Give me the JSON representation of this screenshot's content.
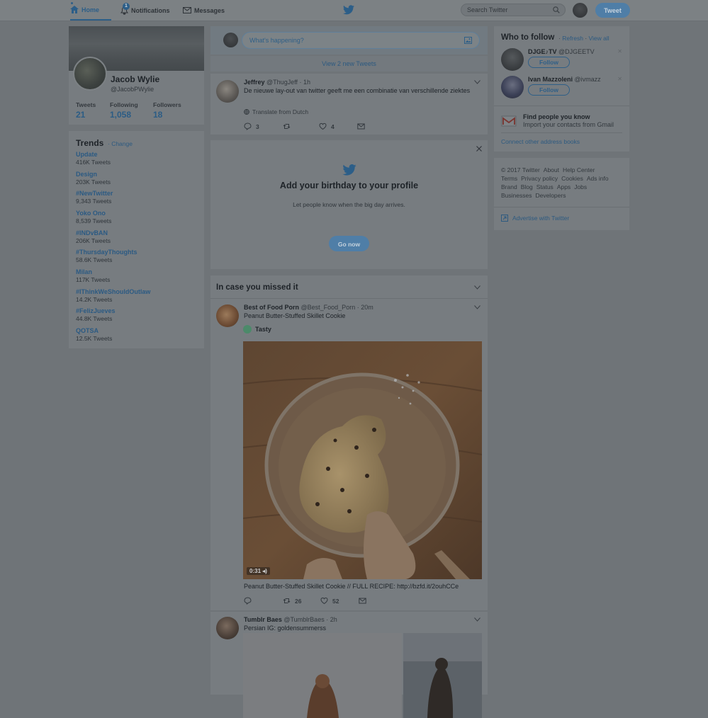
{
  "topbar": {
    "home_label": "Home",
    "notifications_label": "Notifications",
    "notifications_badge": "1",
    "messages_label": "Messages",
    "search_placeholder": "Search Twitter",
    "tweet_button": "Tweet"
  },
  "profile": {
    "name": "Jacob Wylie",
    "handle": "@JacobPWylie",
    "stats": [
      {
        "label": "Tweets",
        "value": "21"
      },
      {
        "label": "Following",
        "value": "1,058"
      },
      {
        "label": "Followers",
        "value": "18"
      }
    ]
  },
  "trends": {
    "title": "Trends",
    "change": "· Change",
    "items": [
      {
        "name": "Update",
        "count": "416K Tweets"
      },
      {
        "name": "Design",
        "count": "203K Tweets"
      },
      {
        "name": "#NewTwitter",
        "count": "9,343 Tweets"
      },
      {
        "name": "Yoko Ono",
        "count": "8,539 Tweets"
      },
      {
        "name": "#INDvBAN",
        "count": "206K Tweets"
      },
      {
        "name": "#ThursdayThoughts",
        "count": "58.6K Tweets"
      },
      {
        "name": "Milan",
        "count": "117K Tweets"
      },
      {
        "name": "#IThinkWeShouldOutlaw",
        "count": "14.2K Tweets"
      },
      {
        "name": "#FelizJueves",
        "count": "44.8K Tweets"
      },
      {
        "name": "QOTSA",
        "count": "12.5K Tweets"
      }
    ]
  },
  "compose": {
    "placeholder": "What's happening?"
  },
  "new_tweets": "View 2 new Tweets",
  "tweet1": {
    "name": "Jeffrey",
    "meta": "@ThugJeff · 1h",
    "text": "De nieuwe lay-out van twitter geeft me een combinatie van verschillende ziektes",
    "translate": "Translate from Dutch",
    "replies": "3",
    "retweets": "",
    "likes": "4"
  },
  "birthday": {
    "title": "Add your birthday to your profile",
    "subtitle": "Let people know when the big day arrives.",
    "button": "Go now"
  },
  "missed": {
    "title": "In case you missed it"
  },
  "tweet2": {
    "name": "Best of Food Porn",
    "meta": "@Best_Food_Porn · 20m",
    "text": "Peanut Butter-Stuffed Skillet Cookie",
    "source": "Tasty",
    "duration": "0:31",
    "caption": "Peanut Butter-Stuffed Skillet Cookie // FULL RECIPE: http://bzfd.it/2ouhCCe",
    "replies": "",
    "retweets": "26",
    "likes": "52"
  },
  "tweet3": {
    "name": "Tumblr Baes",
    "meta": "@TumblrBaes · 2h",
    "text": "Persian IG: goldensummerss"
  },
  "who_to_follow": {
    "title": "Who to follow",
    "refresh": "Refresh",
    "view_all": "View all",
    "suggestions": [
      {
        "name": "DJGE♪TV",
        "handle": "@DJGEETV",
        "button": "Follow"
      },
      {
        "name": "Ivan Mazzoleni",
        "handle": "@ivmazz",
        "button": "Follow"
      }
    ],
    "find_title": "Find people you know",
    "find_sub": "Import your contacts from Gmail",
    "connect": "Connect other address books"
  },
  "footer": {
    "links": [
      "© 2017 Twitter",
      "About",
      "Help Center",
      "Terms",
      "Privacy policy",
      "Cookies",
      "Ads info",
      "Brand",
      "Blog",
      "Status",
      "Apps",
      "Jobs",
      "Businesses",
      "Developers"
    ],
    "advertise": "Advertise with Twitter"
  }
}
